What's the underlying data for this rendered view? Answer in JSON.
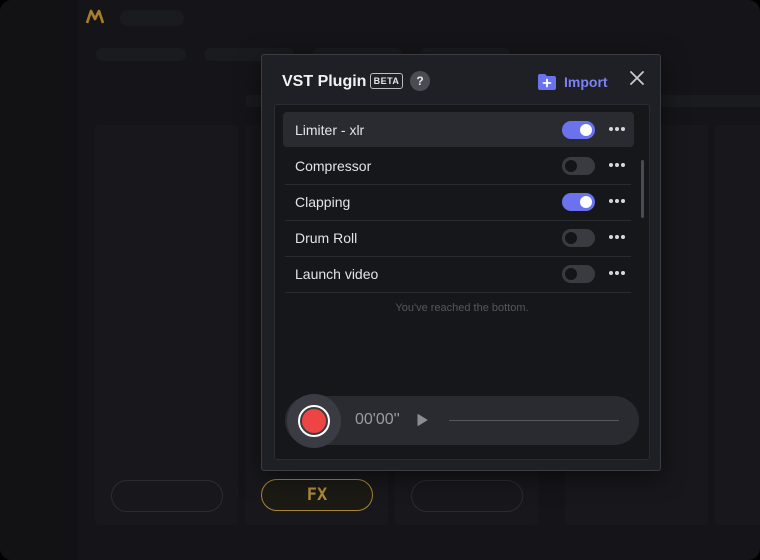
{
  "modal": {
    "title": "VST Plugin",
    "badge": "BETA",
    "help": "?",
    "import_label": "Import",
    "bottom_note": "You've reached the bottom."
  },
  "plugins": [
    {
      "name": "Limiter - xlr",
      "enabled": true,
      "highlighted": true
    },
    {
      "name": "Compressor",
      "enabled": false,
      "highlighted": false
    },
    {
      "name": "Clapping",
      "enabled": true,
      "highlighted": false
    },
    {
      "name": "Drum Roll",
      "enabled": false,
      "highlighted": false
    },
    {
      "name": "Launch video",
      "enabled": false,
      "highlighted": false
    }
  ],
  "recorder": {
    "timer": "00'00''"
  },
  "background": {
    "fx_label": "FX"
  },
  "colors": {
    "accent": "#6a72ee",
    "import": "#7b82f5",
    "record": "#ef4444",
    "fx": "#e8b84a"
  }
}
